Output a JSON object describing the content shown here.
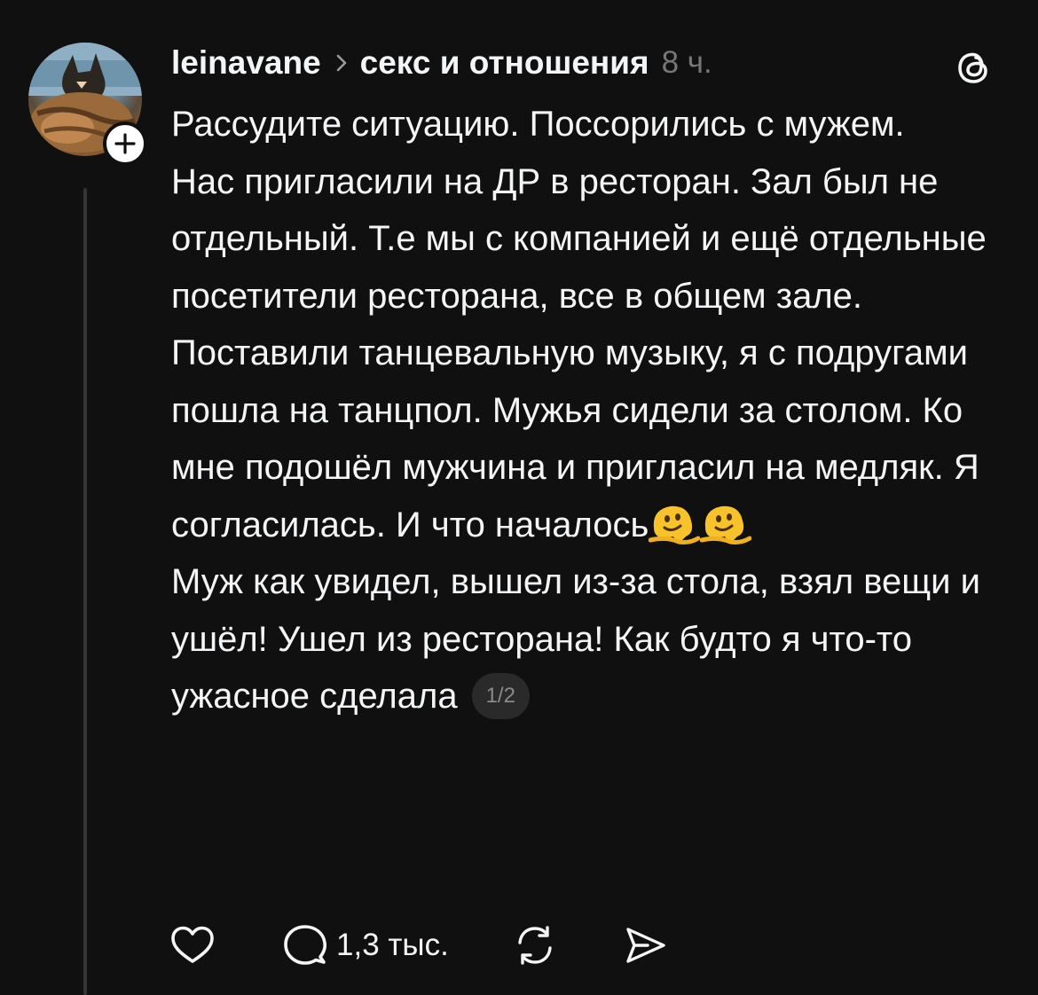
{
  "post": {
    "author": "leinavane",
    "community": "секс и отношения",
    "time": "8 ч.",
    "paragraphs": [
      "Рассудите ситуацию. Поссорились с мужем.",
      "Нас пригласили на ДР в ресторан. Зал был не отдельный. Т.е мы с компанией и ещё отдельные посетители ресторана, все в общем зале.",
      "Поставили танцевальную музыку, я с подругами пошла на танцпол. Мужья сидели за столом. Ко мне подошёл мужчина и пригласил на медляк. Я согласилась. И что началось",
      "Муж как увидел, вышел из-за стола, взял вещи и ушёл! Ушел из ресторана! Как будто я что-то ужасное сделала"
    ],
    "page_indicator": "1/2",
    "icons": {
      "avatar": "avatar-cat-photo",
      "follow": "plus-icon",
      "separator": "chevron-right-icon",
      "app": "threads-logo-icon",
      "emoji": "melting-face-emoji",
      "like": "heart-icon",
      "reply": "comment-bubble-icon",
      "repost": "repost-icon",
      "share": "send-icon"
    }
  },
  "actions": {
    "replies_count": "1,3 тыс."
  },
  "colors": {
    "background": "#101010",
    "text": "#f3f5f7",
    "secondary": "#777777",
    "thread_line": "#333638",
    "badge_bg": "#2a2a2a"
  }
}
